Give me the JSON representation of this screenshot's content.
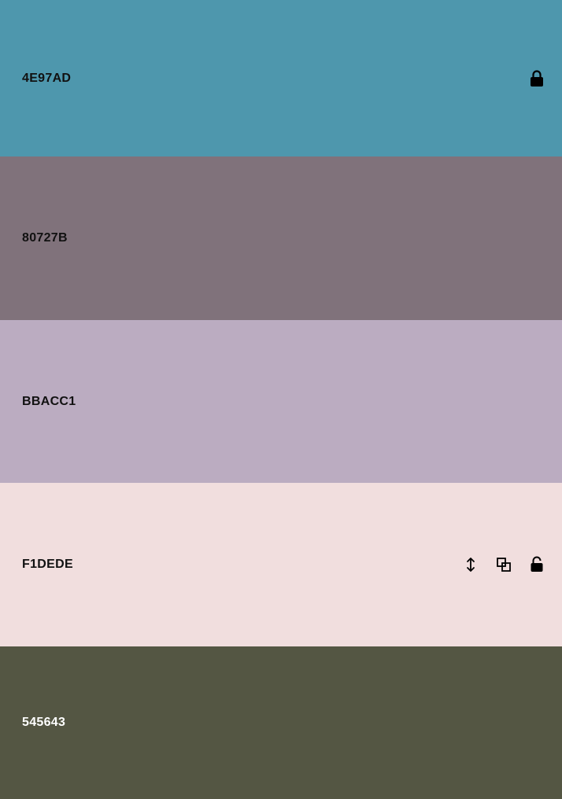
{
  "swatches": [
    {
      "hex": "4E97AD",
      "color": "#4E97AD",
      "text_color": "#111111",
      "locked": true,
      "hovered": false
    },
    {
      "hex": "80727B",
      "color": "#80727B",
      "text_color": "#111111",
      "locked": false,
      "hovered": false
    },
    {
      "hex": "BBACC1",
      "color": "#BBACC1",
      "text_color": "#111111",
      "locked": false,
      "hovered": false
    },
    {
      "hex": "F1DEDE",
      "color": "#F1DEDE",
      "text_color": "#111111",
      "locked": false,
      "hovered": true,
      "visible_icons": [
        "drag-vertical-icon",
        "copy-icon",
        "unlock-icon"
      ]
    },
    {
      "hex": "545643",
      "color": "#545643",
      "text_color": "#ffffff",
      "locked": false,
      "hovered": false
    }
  ]
}
